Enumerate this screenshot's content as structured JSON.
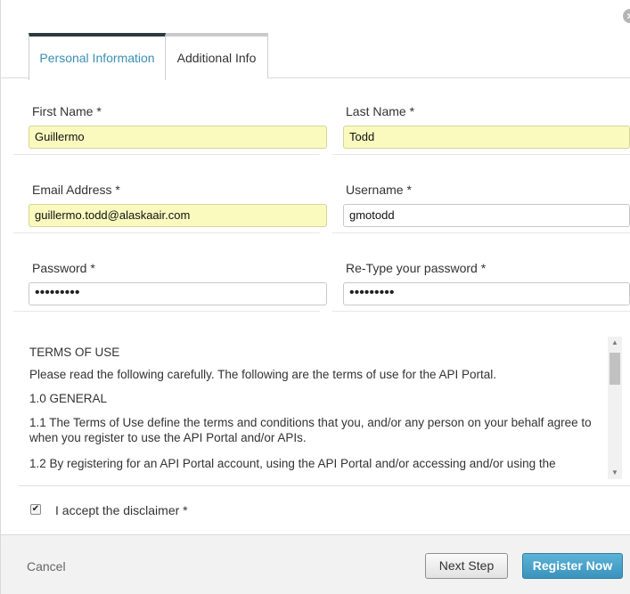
{
  "dialog": {
    "close_glyph": "×"
  },
  "tabs": [
    {
      "label": "Personal Information",
      "active": true
    },
    {
      "label": "Additional Info",
      "active": false
    }
  ],
  "fields": {
    "first_name": {
      "label": "First Name *",
      "value": "Guillermo"
    },
    "last_name": {
      "label": "Last Name *",
      "value": "Todd"
    },
    "email": {
      "label": "Email Address *",
      "value": "guillermo.todd@alaskaair.com"
    },
    "username": {
      "label": "Username *",
      "value": "gmotodd"
    },
    "password": {
      "label": "Password *",
      "value": "•••••••••"
    },
    "retype_password": {
      "label": "Re-Type your password *",
      "value": "•••••••••"
    }
  },
  "terms": {
    "heading": "TERMS OF USE",
    "intro": "Please read the following carefully. The following are the terms of use for the API Portal.",
    "section_1": "1.0 GENERAL",
    "clause_1_1": "1.1 The Terms of Use define the terms and conditions that you, and/or any person on your behalf agree to when you register to use the API Portal and/or APIs.",
    "clause_1_2": "1.2 By registering for an API Portal account, using the API Portal and/or accessing and/or using the"
  },
  "scrollbar": {
    "up_glyph": "▲",
    "down_glyph": "▼"
  },
  "accept": {
    "label": "I accept the disclaimer *",
    "checked": true,
    "check_glyph": "✔"
  },
  "footer": {
    "cancel_label": "Cancel",
    "next_label": "Next Step",
    "register_label": "Register Now"
  },
  "colors": {
    "active_tab_text": "#3a8fb7",
    "autofill_background": "#fafabf",
    "primary_button": "#3a93bd"
  }
}
